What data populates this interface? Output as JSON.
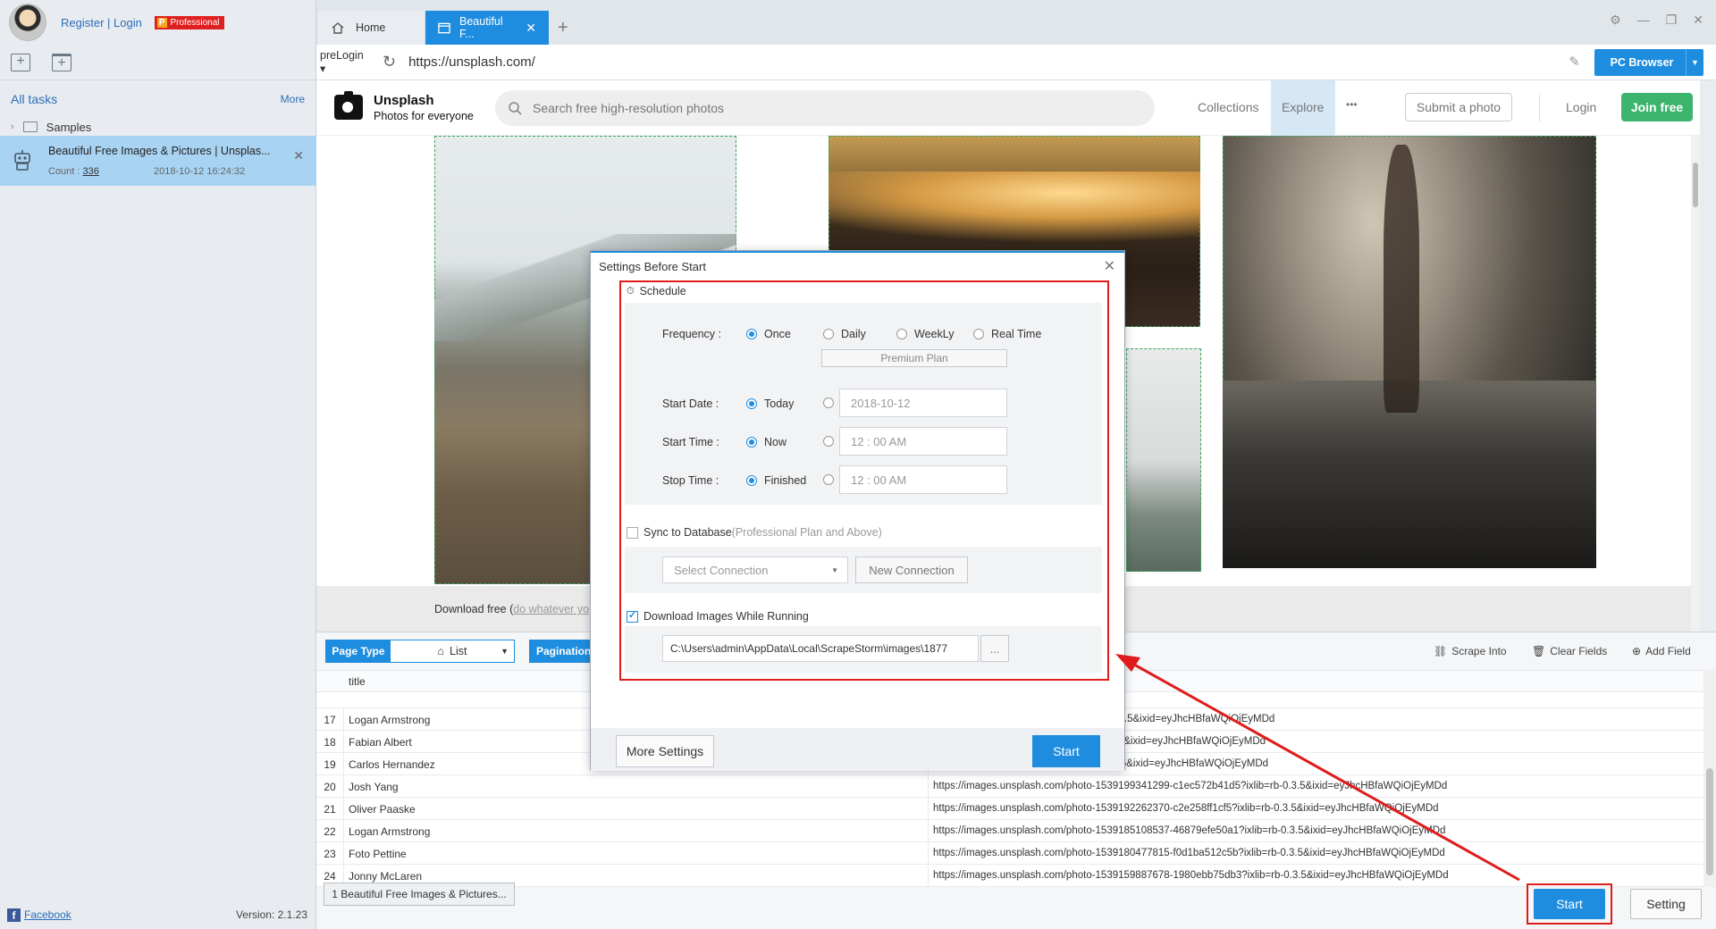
{
  "sidebar": {
    "auth_link": "Register | Login",
    "pro_badge_letter": "P",
    "pro_badge": "Professional",
    "all_tasks": "All tasks",
    "more": "More",
    "samples": "Samples",
    "task": {
      "title": "Beautiful Free Images & Pictures | Unsplas...",
      "count_label": "Count :",
      "count": "336",
      "date": "2018-10-12 16:24:32"
    },
    "facebook": "Facebook",
    "version": "Version: 2.1.23"
  },
  "browser": {
    "tabs": [
      {
        "label": "Home"
      },
      {
        "label": "Beautiful F..."
      }
    ],
    "prelogin": "preLogin",
    "url": "https://unsplash.com/",
    "pc_browser": "PC Browser"
  },
  "unsplash": {
    "name": "Unsplash",
    "tagline": "Photos for everyone",
    "search_placeholder": "Search free high-resolution photos",
    "nav": [
      "Collections",
      "Explore",
      "•••"
    ],
    "submit": "Submit a photo",
    "login": "Login",
    "join": "Join free",
    "download_text": "Download free (",
    "download_link": "do whatever yo"
  },
  "panel": {
    "page_type_label": "Page Type",
    "page_type_value": "List",
    "pagination": "Pagination",
    "scrape_into": "Scrape Into",
    "clear_fields": "Clear Fields",
    "add_field": "Add Field",
    "column_title": "title",
    "rows": [
      {
        "num": "17",
        "name": "Logan Armstrong",
        "img": "19185572723-662460883bed?ixlib=rb-0.3.5&ixid=eyJhcHBfaWQiOjEyMDd"
      },
      {
        "num": "18",
        "name": "Fabian Albert",
        "img": "9171855603-4ea74c32fe82?ixlib=rb-0.3.5&ixid=eyJhcHBfaWQiOjEyMDd"
      },
      {
        "num": "19",
        "name": "Carlos Hernandez",
        "img": "9205811945-74b6444a8200?ixlib=rb-0.3.5&ixid=eyJhcHBfaWQiOjEyMDd"
      },
      {
        "num": "20",
        "name": "Josh Yang",
        "img": "https://images.unsplash.com/photo-1539199341299-c1ec572b41d5?ixlib=rb-0.3.5&ixid=eyJhcHBfaWQiOjEyMDd"
      },
      {
        "num": "21",
        "name": "Oliver Paaske",
        "img": "https://images.unsplash.com/photo-1539192262370-c2e258ff1cf5?ixlib=rb-0.3.5&ixid=eyJhcHBfaWQiOjEyMDd"
      },
      {
        "num": "22",
        "name": "Logan Armstrong",
        "img": "https://images.unsplash.com/photo-1539185108537-46879efe50a1?ixlib=rb-0.3.5&ixid=eyJhcHBfaWQiOjEyMDd"
      },
      {
        "num": "23",
        "name": "Foto Pettine",
        "img": "https://images.unsplash.com/photo-1539180477815-f0d1ba512c5b?ixlib=rb-0.3.5&ixid=eyJhcHBfaWQiOjEyMDd"
      },
      {
        "num": "24",
        "name": "Jonny McLaren",
        "img": "https://images.unsplash.com/photo-1539159887678-1980ebb75db3?ixlib=rb-0.3.5&ixid=eyJhcHBfaWQiOjEyMDd"
      }
    ],
    "bottom_tab": "1 Beautiful Free Images & Pictures...",
    "start": "Start",
    "setting": "Setting"
  },
  "modal": {
    "title": "Settings Before Start",
    "schedule": "Schedule",
    "frequency_label": "Frequency :",
    "freq_options": [
      "Once",
      "Daily",
      "WeekLy",
      "Real Time"
    ],
    "premium_plan": "Premium Plan",
    "start_date_label": "Start Date :",
    "today": "Today",
    "date_value": "2018-10-12",
    "start_time_label": "Start Time :",
    "now": "Now",
    "start_time_value": "12 : 00  AM",
    "stop_time_label": "Stop Time :",
    "finished": "Finished",
    "stop_time_value": "12 : 00  AM",
    "sync_label": "Sync to Database",
    "sync_note": "(Professional Plan and Above)",
    "select_connection": "Select Connection",
    "new_connection": "New Connection",
    "download_images": "Download Images While Running",
    "path_value": "C:\\Users\\admin\\AppData\\Local\\ScrapeStorm\\images\\1877",
    "browse": "...",
    "more_settings": "More Settings",
    "start": "Start"
  },
  "colors": {
    "accent": "#1f8ddf",
    "highlight": "#e01b1b",
    "join_green": "#3cb46e"
  }
}
